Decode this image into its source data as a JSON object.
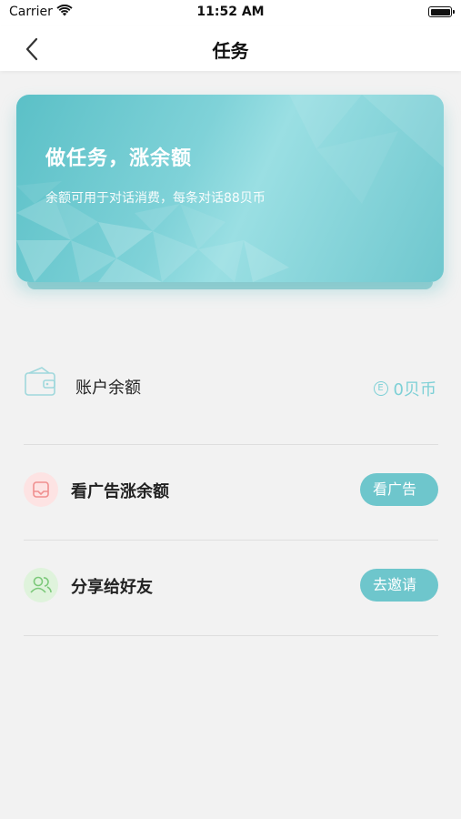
{
  "status_bar": {
    "carrier": "Carrier",
    "time": "11:52 AM"
  },
  "nav": {
    "title": "任务"
  },
  "banner": {
    "title": "做任务，涨余额",
    "subtitle": "余额可用于对话消费，每条对话88贝币"
  },
  "balance": {
    "label": "账户余额",
    "value": "0贝币",
    "coin_symbol": "E"
  },
  "tasks": [
    {
      "label": "看广告涨余额",
      "button": "看广告",
      "icon": "ad-card-icon",
      "icon_color": "#f6a9a9"
    },
    {
      "label": "分享给好友",
      "button": "去邀请",
      "icon": "friends-icon",
      "icon_color": "#8fd68f"
    }
  ],
  "colors": {
    "accent": "#6ec6cc",
    "background": "#f2f2f2"
  }
}
